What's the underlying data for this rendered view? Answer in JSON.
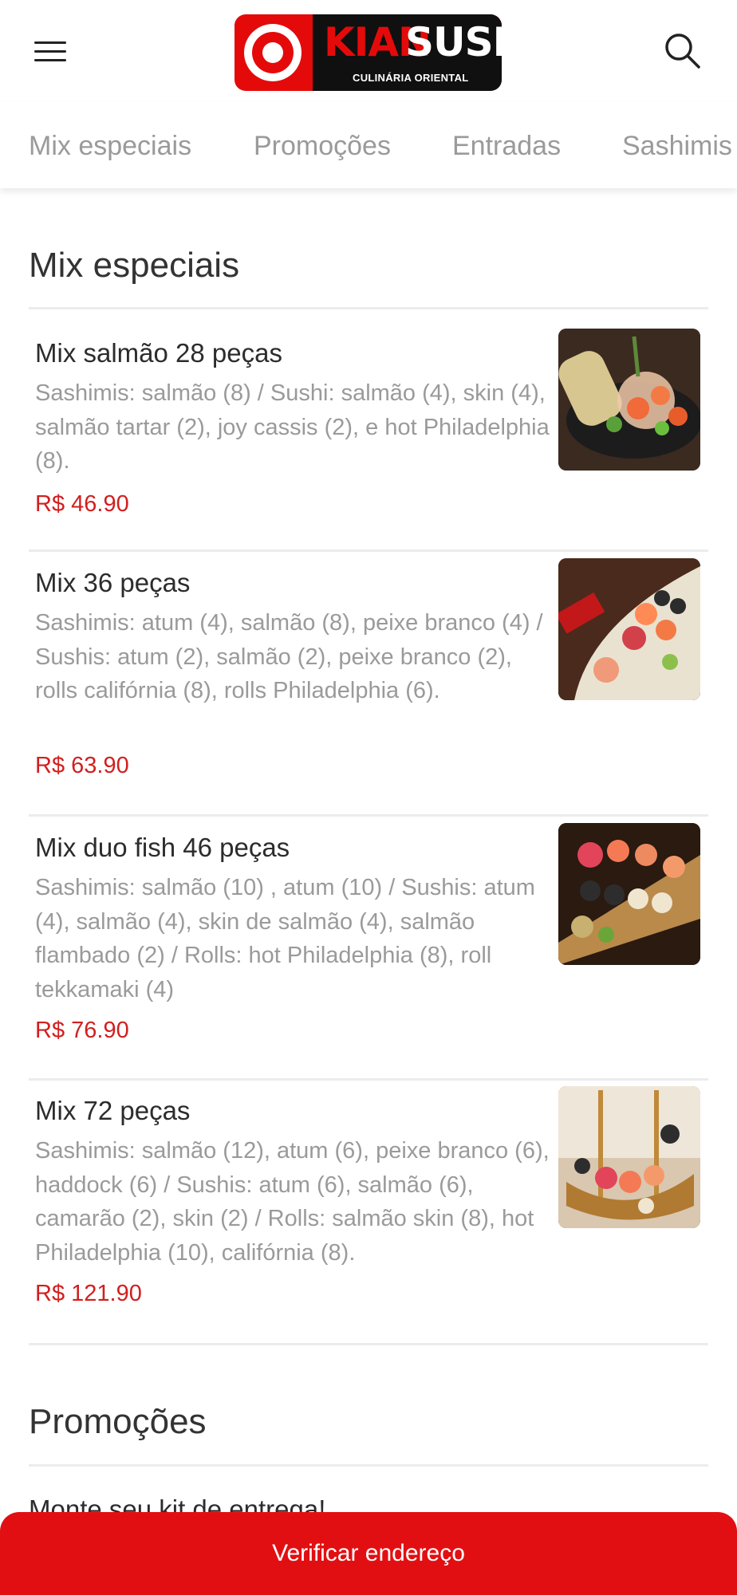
{
  "header": {
    "logo_text_1": "KIAN",
    "logo_text_2": "SUSHI",
    "logo_tagline": "CULINÁRIA ORIENTAL"
  },
  "tabs": [
    {
      "label": "Mix especiais"
    },
    {
      "label": "Promoções"
    },
    {
      "label": "Entradas"
    },
    {
      "label": "Sashimis"
    }
  ],
  "sections": [
    {
      "title": "Mix especiais",
      "items": [
        {
          "name": "Mix salmão 28 peças",
          "description": "Sashimis: salmão (8) / Sushi: salmão (4), skin (4), salmão tartar (2), joy cassis (2), e hot Philadelphia (8).",
          "price": "R$ 46.90"
        },
        {
          "name": "Mix 36 peças",
          "description": "Sashimis: atum (4), salmão (8), peixe branco (4) / Sushis: atum (2), salmão (2), peixe branco (2), rolls califórnia (8), rolls Philadelphia (6).",
          "price": "R$ 63.90"
        },
        {
          "name": "Mix duo fish 46 peças",
          "description": "Sashimis: salmão (10) , atum (10) / Sushis: atum (4), salmão (4), skin de salmão (4), salmão flambado (2) / Rolls: hot Philadelphia (8), roll tekkamaki (4)",
          "price": "R$ 76.90"
        },
        {
          "name": "Mix 72 peças",
          "description": "Sashimis: salmão (12), atum (6), peixe branco (6), haddock (6) / Sushis: atum (6), salmão (6), camarão (2), skin (2) / Rolls: salmão skin (8), hot Philadelphia (10), califórnia (8).",
          "price": "R$ 121.90"
        }
      ]
    },
    {
      "title": "Promoções",
      "items": [
        {
          "name": "Monte seu kit de entrega!"
        }
      ]
    }
  ],
  "cta": {
    "label": "Verificar endereço"
  },
  "colors": {
    "brand_red": "#e20f12",
    "price_red": "#d21f1f",
    "muted_text": "#9a9a9a"
  }
}
